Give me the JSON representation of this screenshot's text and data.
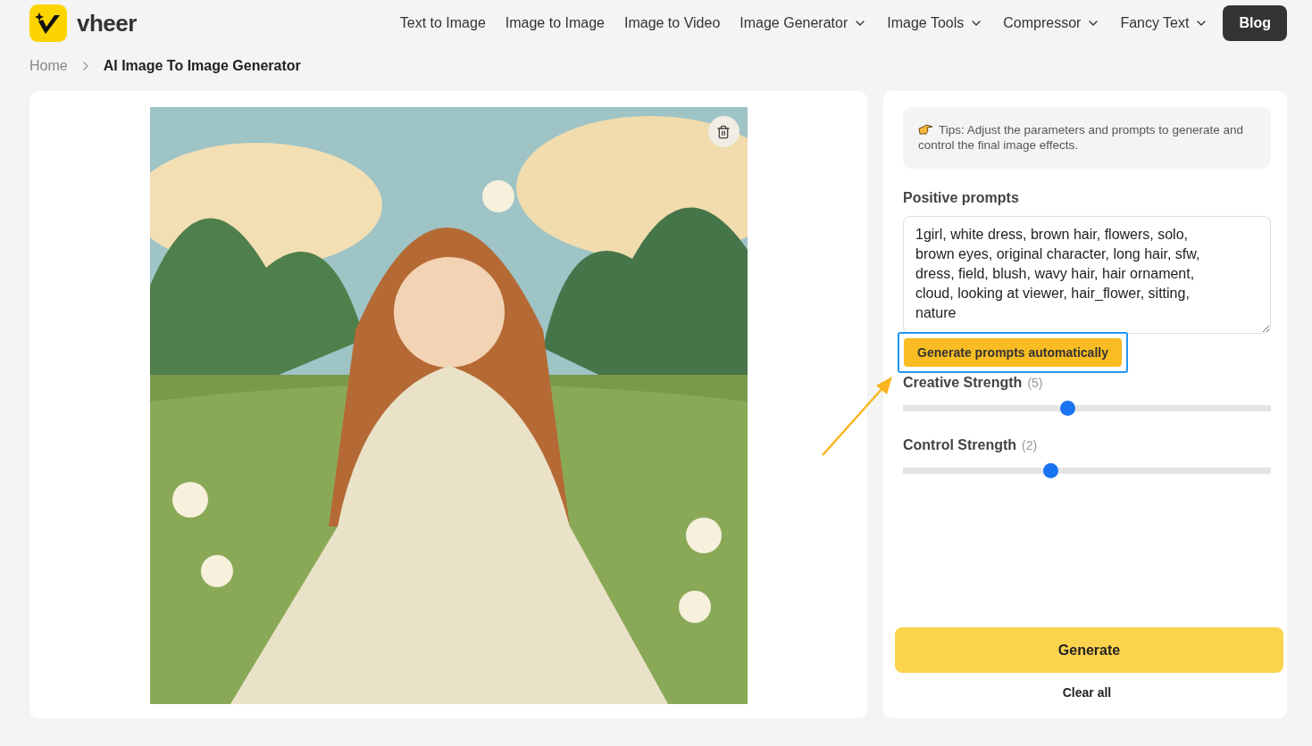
{
  "header": {
    "logo_text": "vheer",
    "nav": [
      {
        "label": "Text to Image",
        "dropdown": false
      },
      {
        "label": "Image to Image",
        "dropdown": false
      },
      {
        "label": "Image to Video",
        "dropdown": false
      },
      {
        "label": "Image Generator",
        "dropdown": true
      },
      {
        "label": "Image Tools",
        "dropdown": true
      },
      {
        "label": "Compressor",
        "dropdown": true
      },
      {
        "label": "Fancy Text",
        "dropdown": true
      }
    ],
    "blog_button": "Blog"
  },
  "breadcrumb": [
    {
      "label": "Home",
      "current": false
    },
    {
      "label": "AI Image To Image Generator",
      "current": true
    }
  ],
  "settings": {
    "tip": "Tips: Adjust the parameters and prompts to generate and control the final image effects.",
    "prompt_label": "Positive prompts",
    "prompt_value": "1girl, white dress, brown hair, flowers, solo, brown eyes, original character, long hair, sfw, dress, field, blush, wavy hair, hair ornament, cloud, looking at viewer, hair_flower, sitting, nature",
    "auto_button": {
      "label": "Generate prompts automatically",
      "highlighted": true
    },
    "sliders": [
      {
        "label": "Creative Strength",
        "value": "(5)",
        "level": 0.447
      },
      {
        "label": "Control Strength",
        "value": "(2)",
        "level": 0.4
      }
    ],
    "generate_button": "Generate",
    "clear_button": "Clear all"
  }
}
